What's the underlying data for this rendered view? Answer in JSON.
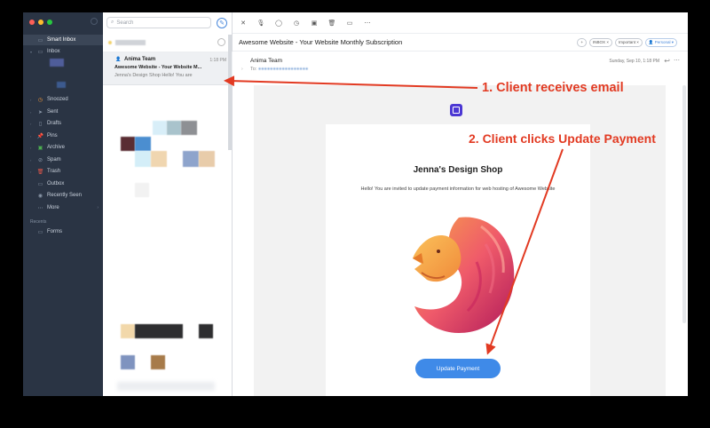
{
  "sidebar": {
    "items": [
      {
        "label": "Smart Inbox",
        "icon": "smart-inbox-icon",
        "active": true
      },
      {
        "label": "Inbox",
        "icon": "inbox-icon"
      },
      {
        "label": "Snoozed",
        "icon": "clock-icon"
      },
      {
        "label": "Sent",
        "icon": "send-icon"
      },
      {
        "label": "Drafts",
        "icon": "draft-icon"
      },
      {
        "label": "Pins",
        "icon": "pin-icon"
      },
      {
        "label": "Archive",
        "icon": "archive-icon"
      },
      {
        "label": "Spam",
        "icon": "spam-icon"
      },
      {
        "label": "Trash",
        "icon": "trash-icon"
      },
      {
        "label": "Outbox",
        "icon": "outbox-icon"
      },
      {
        "label": "Recently Seen",
        "icon": "eye-icon"
      },
      {
        "label": "More",
        "icon": "more-icon"
      }
    ],
    "recents_label": "Recents",
    "recents": [
      {
        "label": "Forms",
        "icon": "folder-icon"
      }
    ]
  },
  "list": {
    "search_placeholder": "Search",
    "selected": {
      "sender": "Anima Team",
      "time": "1:18 PM",
      "subject": "Awesome Website - Your Website M...",
      "preview": "Jenna's Design Shop Hello! You are"
    }
  },
  "pane": {
    "subject": "Awesome Website - Your Website Monthly Subscription",
    "tags": [
      "INBOX",
      "Important",
      "Personal"
    ],
    "from": "Anima Team",
    "to_label": "To:",
    "date": "Sunday, Sep 10, 1:18 PM",
    "email": {
      "shop_name": "Jenna's Design Shop",
      "invite": "Hello! You are invited to update payment information for web hosting of Awesome Website",
      "button": "Update Payment"
    }
  },
  "annotations": {
    "step1": "1. Client receives email",
    "step2": "2. Client clicks Update Payment"
  },
  "colors": {
    "sidebar_bg": "#2a3444",
    "accent": "#3f8ae8",
    "annotation": "#e23a22",
    "logo": "#4b37d3"
  }
}
